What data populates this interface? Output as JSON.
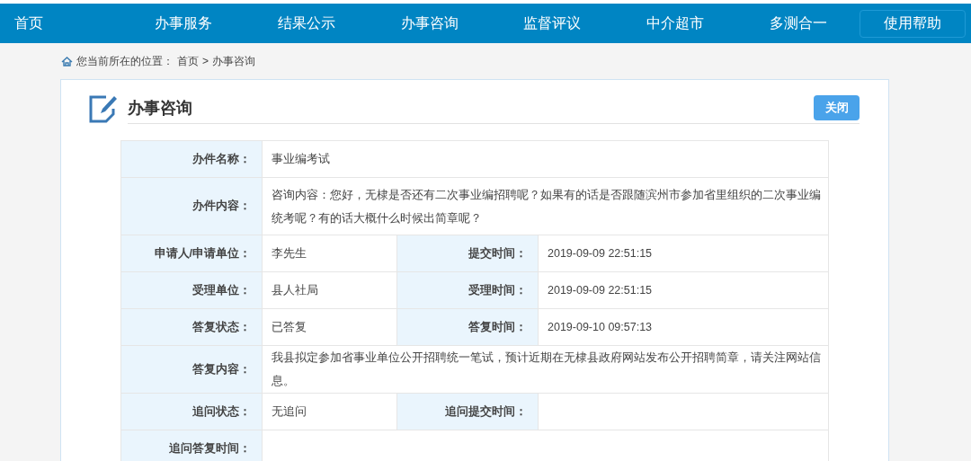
{
  "nav": {
    "items": [
      {
        "label": "首页"
      },
      {
        "label": "办事服务"
      },
      {
        "label": "结果公示"
      },
      {
        "label": "办事咨询"
      },
      {
        "label": "监督评议"
      },
      {
        "label": "中介超市"
      },
      {
        "label": "多测合一"
      }
    ],
    "help": "使用帮助"
  },
  "breadcrumb": {
    "prefix": "您当前所在的位置：",
    "path": [
      "首页",
      "办事咨询"
    ],
    "separator": ">"
  },
  "panel": {
    "title": "办事咨询",
    "close": "关闭",
    "rows": [
      {
        "pairs": [
          {
            "label": "办件名称：",
            "value": "事业编考试"
          }
        ]
      },
      {
        "pairs": [
          {
            "label": "办件内容：",
            "value": "咨询内容：您好，无棣是否还有二次事业编招聘呢？如果有的话是否跟随滨州市参加省里组织的二次事业编统考呢？有的话大概什么时候出简章呢？"
          }
        ]
      },
      {
        "pairs": [
          {
            "label": "申请人/申请单位：",
            "value": "李先生"
          },
          {
            "label": "提交时间：",
            "value": "2019-09-09 22:51:15"
          }
        ]
      },
      {
        "pairs": [
          {
            "label": "受理单位：",
            "value": "县人社局"
          },
          {
            "label": "受理时间：",
            "value": "2019-09-09 22:51:15"
          }
        ]
      },
      {
        "pairs": [
          {
            "label": "答复状态：",
            "value": "已答复"
          },
          {
            "label": "答复时间：",
            "value": "2019-09-10 09:57:13"
          }
        ]
      },
      {
        "pairs": [
          {
            "label": "答复内容：",
            "value": "我县拟定参加省事业单位公开招聘统一笔试，预计近期在无棣县政府网站发布公开招聘简章，请关注网站信息。"
          }
        ]
      },
      {
        "pairs": [
          {
            "label": "追问状态：",
            "value": "无追问"
          },
          {
            "label": "追问提交时间："
          }
        ]
      },
      {
        "pairs": [
          {
            "label": "追问答复时间："
          }
        ]
      }
    ]
  }
}
